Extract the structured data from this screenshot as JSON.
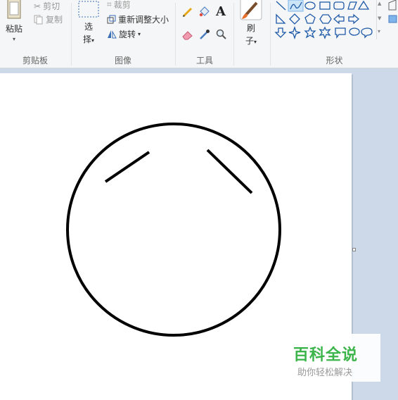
{
  "clipboard": {
    "paste_label": "粘贴",
    "cut_label": "剪切",
    "copy_label": "复制",
    "group_label": "剪贴板"
  },
  "image": {
    "select_label_1": "选",
    "select_label_2": "择",
    "crop_label": "裁剪",
    "resize_label": "重新调整大小",
    "rotate_label": "旋转",
    "group_label": "图像"
  },
  "tools": {
    "text_tool_glyph": "A",
    "group_label": "工具"
  },
  "brushes": {
    "label_1": "刷",
    "label_2": "子"
  },
  "shapes": {
    "group_label": "形状"
  },
  "watermark": {
    "title": "百科全说",
    "subtitle": "助你轻松解决"
  }
}
